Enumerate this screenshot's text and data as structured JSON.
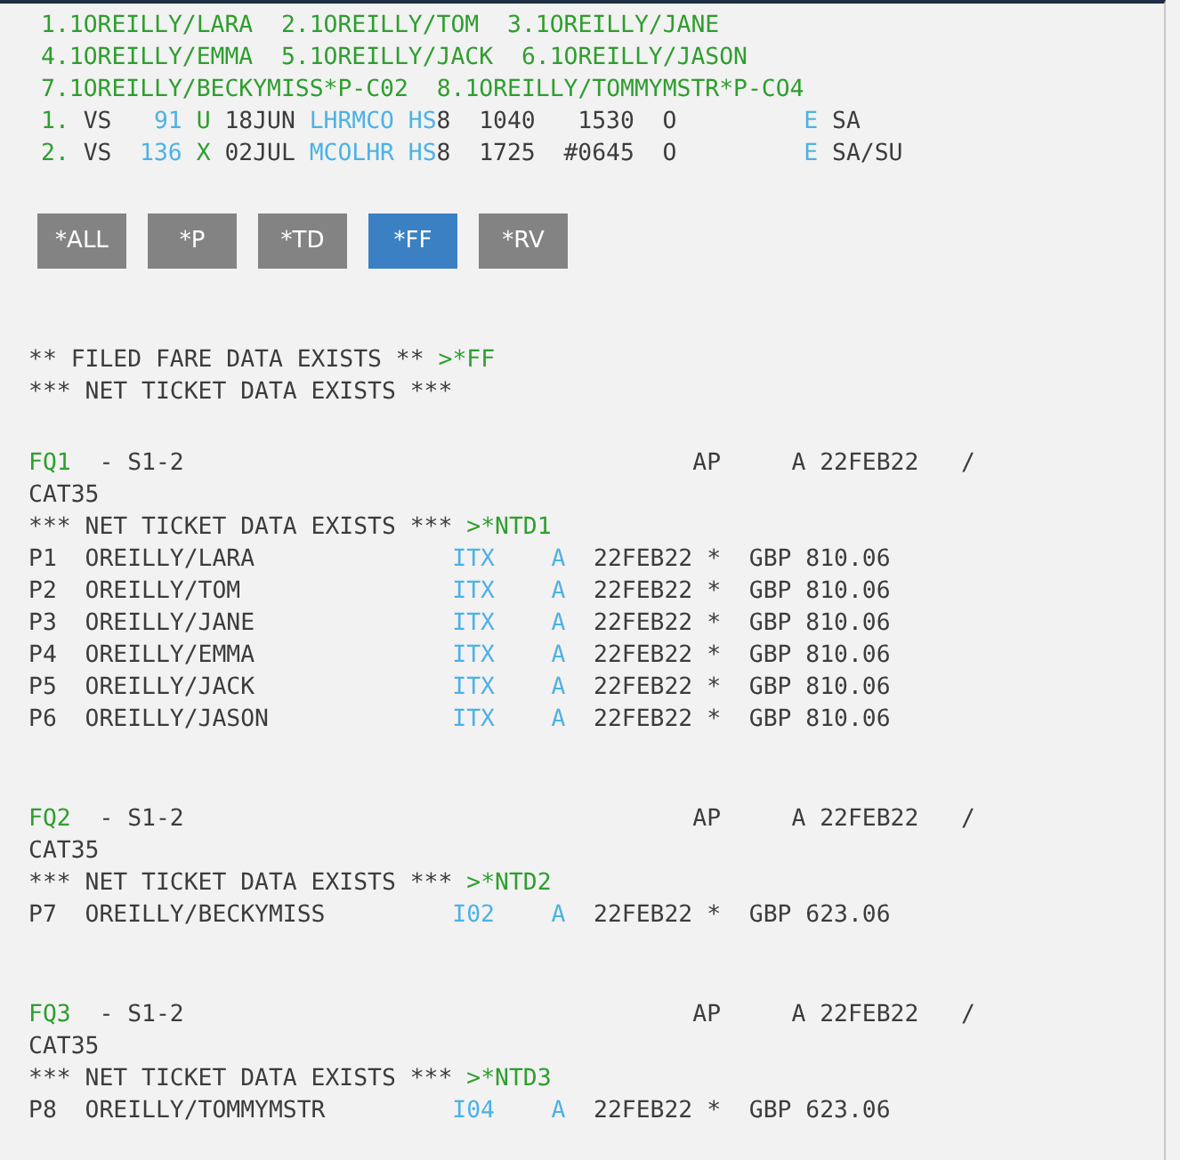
{
  "passenger_lines": [
    [
      "1.1OREILLY/LARA",
      "2.1OREILLY/TOM",
      "3.1OREILLY/JANE"
    ],
    [
      "4.1OREILLY/EMMA",
      "5.1OREILLY/JACK",
      "6.1OREILLY/JASON"
    ],
    [
      "7.1OREILLY/BECKYMISS*P-C02",
      "8.1OREILLY/TOMMYMSTR*P-CO4"
    ]
  ],
  "segments": [
    {
      "number": "1.",
      "airline": "VS",
      "flight": "91",
      "class": "U",
      "date": "18JUN",
      "route": "LHRMCO",
      "status": "HS",
      "count": "8",
      "departure": "1040",
      "arrival": "1530",
      "column_11": "O",
      "column_12": "E",
      "column_13": "SA"
    },
    {
      "number": "2.",
      "airline": "VS",
      "flight": "136",
      "class": "X",
      "date": "02JUL",
      "route": "MCOLHR",
      "status": "HS",
      "count": "8",
      "departure": "1725",
      "arrival": "#0645",
      "column_11": "O",
      "column_12": "E",
      "column_13": "SA/SU"
    }
  ],
  "buttons": [
    {
      "label": "*ALL",
      "selected": false
    },
    {
      "label": "*P",
      "selected": false
    },
    {
      "label": "*TD",
      "selected": false
    },
    {
      "label": "*FF",
      "selected": true
    },
    {
      "label": "*RV",
      "selected": false
    }
  ],
  "notices": [
    {
      "text": "** FILED FARE DATA EXISTS **",
      "command": ">*FF"
    },
    {
      "text": "*** NET TICKET DATA EXISTS ***"
    }
  ],
  "fare_quotes": [
    {
      "id": "FQ1",
      "segments": "- S1-2",
      "column_3": "AP",
      "column_4": "A",
      "date": "22FEB22",
      "column_6": "/",
      "category": "CAT35",
      "notice": "*** NET TICKET DATA EXISTS ***",
      "command": ">*NTD1",
      "passengers": [
        {
          "ref": "P1",
          "name": "OREILLY/LARA",
          "fare_basis": "ITX",
          "status": "A",
          "date": "22FEB22",
          "mark": "*",
          "currency": "GBP",
          "amount": "810.06"
        },
        {
          "ref": "P2",
          "name": "OREILLY/TOM",
          "fare_basis": "ITX",
          "status": "A",
          "date": "22FEB22",
          "mark": "*",
          "currency": "GBP",
          "amount": "810.06"
        },
        {
          "ref": "P3",
          "name": "OREILLY/JANE",
          "fare_basis": "ITX",
          "status": "A",
          "date": "22FEB22",
          "mark": "*",
          "currency": "GBP",
          "amount": "810.06"
        },
        {
          "ref": "P4",
          "name": "OREILLY/EMMA",
          "fare_basis": "ITX",
          "status": "A",
          "date": "22FEB22",
          "mark": "*",
          "currency": "GBP",
          "amount": "810.06"
        },
        {
          "ref": "P5",
          "name": "OREILLY/JACK",
          "fare_basis": "ITX",
          "status": "A",
          "date": "22FEB22",
          "mark": "*",
          "currency": "GBP",
          "amount": "810.06"
        },
        {
          "ref": "P6",
          "name": "OREILLY/JASON",
          "fare_basis": "ITX",
          "status": "A",
          "date": "22FEB22",
          "mark": "*",
          "currency": "GBP",
          "amount": "810.06"
        }
      ]
    },
    {
      "id": "FQ2",
      "segments": "- S1-2",
      "column_3": "AP",
      "column_4": "A",
      "date": "22FEB22",
      "column_6": "/",
      "category": "CAT35",
      "notice": "*** NET TICKET DATA EXISTS ***",
      "command": ">*NTD2",
      "passengers": [
        {
          "ref": "P7",
          "name": "OREILLY/BECKYMISS",
          "fare_basis": "I02",
          "status": "A",
          "date": "22FEB22",
          "mark": "*",
          "currency": "GBP",
          "amount": "623.06"
        }
      ]
    },
    {
      "id": "FQ3",
      "segments": "- S1-2",
      "column_3": "AP",
      "column_4": "A",
      "date": "22FEB22",
      "column_6": "/",
      "category": "CAT35",
      "notice": "*** NET TICKET DATA EXISTS ***",
      "command": ">*NTD3",
      "passengers": [
        {
          "ref": "P8",
          "name": "OREILLY/TOMMYMSTR",
          "fare_basis": "I04",
          "status": "A",
          "date": "22FEB22",
          "mark": "*",
          "currency": "GBP",
          "amount": "623.06"
        }
      ]
    }
  ]
}
